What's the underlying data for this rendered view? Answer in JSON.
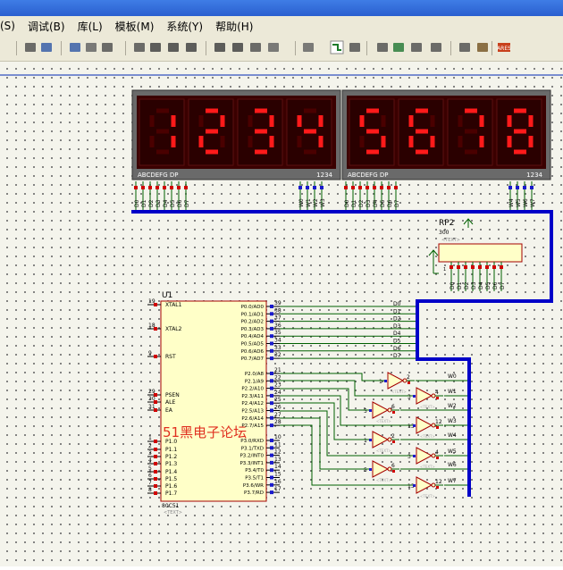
{
  "menu": [
    "(S)",
    "调试(B)",
    "库(L)",
    "模板(M)",
    "系统(Y)",
    "帮助(H)"
  ],
  "toolbar_icons": [
    "arrow-icon",
    "undo-icon",
    "redo-icon",
    "cut-icon",
    "copy-icon",
    "paste-icon",
    "block-copy-icon",
    "block-move-icon",
    "block-rotate-icon",
    "block-delete-icon",
    "pick-device-icon",
    "make-device-icon",
    "package-tool-icon",
    "decompose-icon",
    "wire-autorouter-icon",
    "search-tag-icon",
    "property-tool-icon",
    "new-sheet-icon",
    "remove-sheet-icon",
    "exit-to-parent-icon",
    "bill-of-materials-icon",
    "electrical-rule-check-icon",
    "netlist-to-ares-icon"
  ],
  "display_left": {
    "digits": "1234",
    "segment_label": "ABCDEFG  DP",
    "pos_label": "1234",
    "pins": [
      "D0",
      "D1",
      "D2",
      "D3",
      "D4",
      "D5",
      "D6",
      "D7"
    ],
    "com_pins": [
      "W0",
      "W1",
      "W2",
      "W3"
    ]
  },
  "display_right": {
    "digits": "5678",
    "segment_label": "ABCDEFG  DP",
    "pos_label": "1234",
    "pins": [
      "D0",
      "D1",
      "D2",
      "D3",
      "D4",
      "D5",
      "D6",
      "D7"
    ],
    "com_pins": [
      "W4",
      "W5",
      "W6",
      "W7"
    ]
  },
  "rp2": {
    "ref": "RP2",
    "value": "300",
    "text": "<TEXT>",
    "pins": [
      "D0",
      "D1",
      "D2",
      "D3",
      "D4",
      "D5",
      "D6",
      "D7"
    ]
  },
  "u1": {
    "ref": "U1",
    "part": "80C51",
    "text": "<TEXT>",
    "left": [
      {
        "num": "19",
        "name": "XTAL1"
      },
      {
        "num": "18",
        "name": "XTAL2"
      },
      {
        "num": "9",
        "name": "RST"
      },
      {
        "num": "29",
        "name": "PSEN"
      },
      {
        "num": "30",
        "name": "ALE"
      },
      {
        "num": "31",
        "name": "EA"
      },
      {
        "num": "1",
        "name": "P1.0"
      },
      {
        "num": "2",
        "name": "P1.1"
      },
      {
        "num": "3",
        "name": "P1.2"
      },
      {
        "num": "4",
        "name": "P1.3"
      },
      {
        "num": "5",
        "name": "P1.4"
      },
      {
        "num": "6",
        "name": "P1.5"
      },
      {
        "num": "7",
        "name": "P1.6"
      },
      {
        "num": "8",
        "name": "P1.7"
      }
    ],
    "p0": [
      {
        "num": "39",
        "name": "P0.0/AD0"
      },
      {
        "num": "38",
        "name": "P0.1/AD1"
      },
      {
        "num": "37",
        "name": "P0.2/AD2"
      },
      {
        "num": "36",
        "name": "P0.3/AD3"
      },
      {
        "num": "35",
        "name": "P0.4/AD4"
      },
      {
        "num": "34",
        "name": "P0.5/AD5"
      },
      {
        "num": "33",
        "name": "P0.6/AD6"
      },
      {
        "num": "32",
        "name": "P0.7/AD7"
      }
    ],
    "p2": [
      {
        "num": "21",
        "name": "P2.0/A8"
      },
      {
        "num": "22",
        "name": "P2.1/A9"
      },
      {
        "num": "23",
        "name": "P2.2/A10"
      },
      {
        "num": "24",
        "name": "P2.3/A11"
      },
      {
        "num": "25",
        "name": "P2.4/A12"
      },
      {
        "num": "26",
        "name": "P2.5/A13"
      },
      {
        "num": "27",
        "name": "P2.6/A14"
      },
      {
        "num": "28",
        "name": "P2.7/A15"
      }
    ],
    "p3": [
      {
        "num": "10",
        "name": "P3.0/RXD"
      },
      {
        "num": "11",
        "name": "P3.1/TXD"
      },
      {
        "num": "12",
        "name": "P3.2/INT0"
      },
      {
        "num": "13",
        "name": "P3.3/INT1"
      },
      {
        "num": "14",
        "name": "P3.4/T0"
      },
      {
        "num": "15",
        "name": "P3.5/T1"
      },
      {
        "num": "16",
        "name": "P3.6/WR"
      },
      {
        "num": "17",
        "name": "P3.7/RD"
      }
    ]
  },
  "p0_nets": [
    "D0",
    "D1",
    "D2",
    "D3",
    "D4",
    "D5",
    "D6",
    "D7"
  ],
  "inverters": [
    {
      "in": "1",
      "out": "2",
      "net": "W0"
    },
    {
      "in": "3",
      "out": "4",
      "net": "W1"
    },
    {
      "in": "5",
      "out": "6",
      "net": "W2"
    },
    {
      "in": "13",
      "out": "12",
      "net": "W3"
    },
    {
      "in": "1",
      "out": "2",
      "net": "W4"
    },
    {
      "in": "3",
      "out": "4",
      "net": "W5"
    },
    {
      "in": "5",
      "out": "6",
      "net": "W6"
    },
    {
      "in": "13",
      "out": "12",
      "net": "W7"
    }
  ],
  "gate_text": "<TEXT>",
  "watermark": "51黑电子论坛",
  "colors": {
    "bus": "#0000c8",
    "wire": "#006000",
    "component": "#a40000",
    "body": "#ffffc8",
    "digit_on": "#ff1a1a",
    "digit_off": "#4a0000",
    "display_bg": "#3a0000"
  }
}
